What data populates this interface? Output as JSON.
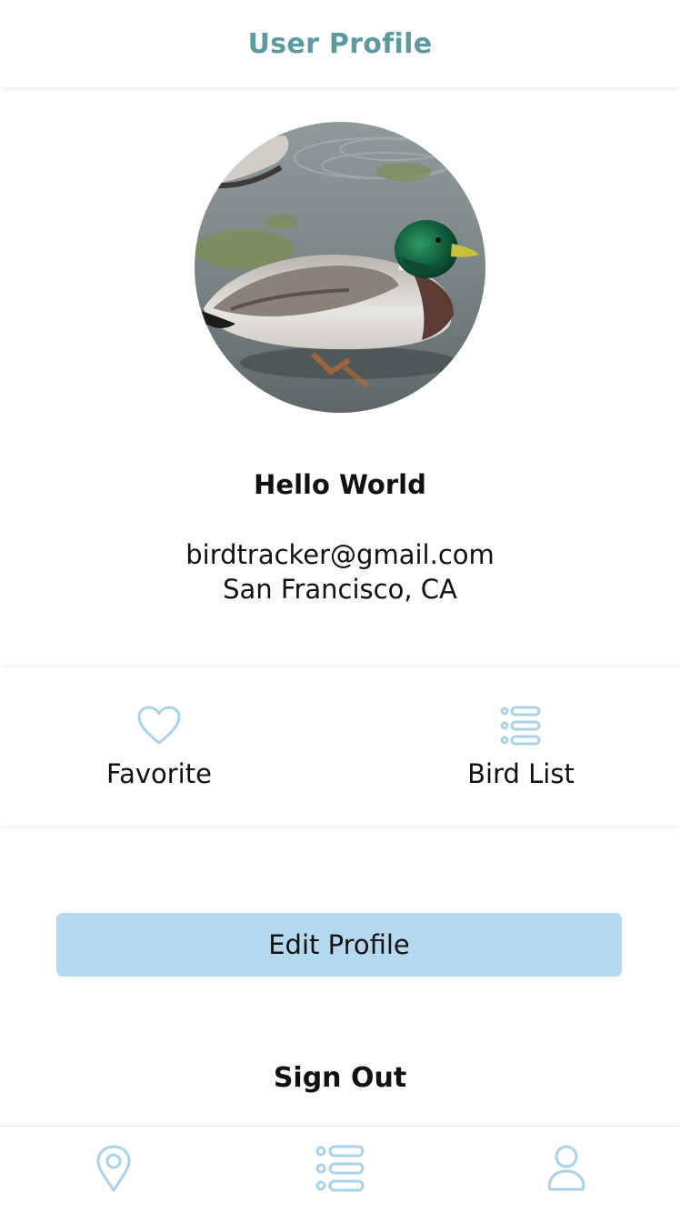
{
  "header": {
    "title": "User Profile"
  },
  "profile": {
    "avatar_icon": "mallard-duck-photo",
    "name": "Hello World",
    "email": "birdtracker@gmail.com",
    "location": "San Francisco, CA"
  },
  "actions": [
    {
      "label": "Favorite",
      "icon": "heart-icon"
    },
    {
      "label": "Bird List",
      "icon": "list-icon"
    }
  ],
  "edit_profile_label": "Edit Profile",
  "sign_out_label": "Sign Out",
  "tabbar": [
    {
      "icon": "map-pin-icon"
    },
    {
      "icon": "list-icon"
    },
    {
      "icon": "user-icon"
    }
  ],
  "colors": {
    "accent_title": "#5b9aa0",
    "icon_blue": "#a9d3ea",
    "button_bg": "#b4d9ee"
  }
}
